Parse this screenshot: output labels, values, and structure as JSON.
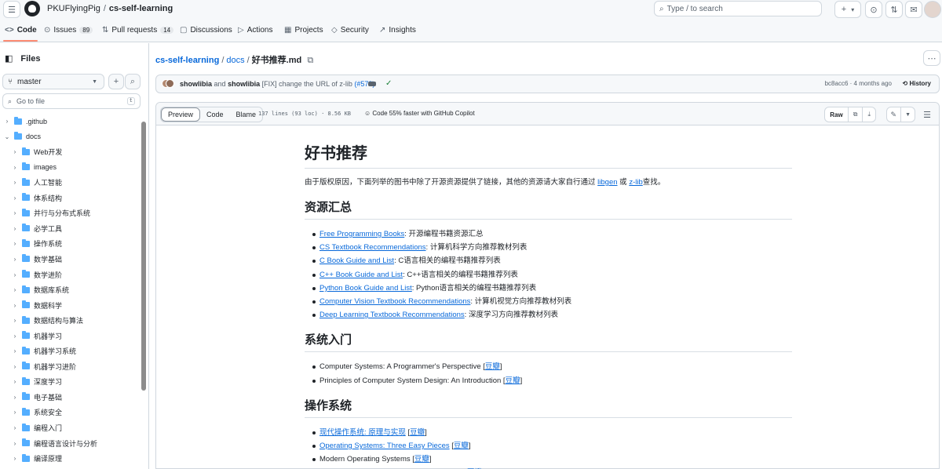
{
  "header": {
    "owner": "PKUFlyingPig",
    "repo": "cs-self-learning",
    "search_placeholder": "Type / to search",
    "search_key": "/",
    "plus": "+",
    "dropdown": "▾"
  },
  "tabs": [
    {
      "label": "Code",
      "icon": "<>",
      "count": ""
    },
    {
      "label": "Issues",
      "icon": "⊙",
      "count": "89"
    },
    {
      "label": "Pull requests",
      "icon": "⇅",
      "count": "14"
    },
    {
      "label": "Discussions",
      "icon": "▢",
      "count": ""
    },
    {
      "label": "Actions",
      "icon": "▷",
      "count": ""
    },
    {
      "label": "Projects",
      "icon": "▦",
      "count": ""
    },
    {
      "label": "Security",
      "icon": "◇",
      "count": ""
    },
    {
      "label": "Insights",
      "icon": "↗",
      "count": ""
    }
  ],
  "sidebar": {
    "title": "Files",
    "branch": "master",
    "goto_placeholder": "Go to file",
    "goto_key": "t",
    "items": [
      {
        "label": ".github",
        "expanded": false,
        "level": 0
      },
      {
        "label": "docs",
        "expanded": true,
        "level": 0
      },
      {
        "label": "Web开发",
        "expanded": false,
        "level": 1
      },
      {
        "label": "images",
        "expanded": false,
        "level": 1
      },
      {
        "label": "人工智能",
        "expanded": false,
        "level": 1
      },
      {
        "label": "体系结构",
        "expanded": false,
        "level": 1
      },
      {
        "label": "并行与分布式系统",
        "expanded": false,
        "level": 1
      },
      {
        "label": "必学工具",
        "expanded": false,
        "level": 1
      },
      {
        "label": "操作系统",
        "expanded": false,
        "level": 1
      },
      {
        "label": "数学基础",
        "expanded": false,
        "level": 1
      },
      {
        "label": "数学进阶",
        "expanded": false,
        "level": 1
      },
      {
        "label": "数据库系统",
        "expanded": false,
        "level": 1
      },
      {
        "label": "数据科学",
        "expanded": false,
        "level": 1
      },
      {
        "label": "数据结构与算法",
        "expanded": false,
        "level": 1
      },
      {
        "label": "机器学习",
        "expanded": false,
        "level": 1
      },
      {
        "label": "机器学习系统",
        "expanded": false,
        "level": 1
      },
      {
        "label": "机器学习进阶",
        "expanded": false,
        "level": 1
      },
      {
        "label": "深度学习",
        "expanded": false,
        "level": 1
      },
      {
        "label": "电子基础",
        "expanded": false,
        "level": 1
      },
      {
        "label": "系统安全",
        "expanded": false,
        "level": 1
      },
      {
        "label": "编程入门",
        "expanded": false,
        "level": 1
      },
      {
        "label": "编程语言设计与分析",
        "expanded": false,
        "level": 1
      },
      {
        "label": "编译原理",
        "expanded": false,
        "level": 1
      }
    ]
  },
  "breadcrumb": {
    "repo": "cs-self-learning",
    "dir": "docs",
    "file": "好书推荐.md"
  },
  "commit": {
    "author1": "showlibia",
    "and": "and",
    "author2": "showlibia",
    "message": "[FIX] change the URL of z-lib",
    "pr": "(#578)",
    "hash_time": "bc8acc6 · 4 months ago",
    "history": "History"
  },
  "file_header": {
    "views": [
      "Preview",
      "Code",
      "Blame"
    ],
    "meta": "137 lines (93 loc) · 8.56 KB",
    "copilot": "Code 55% faster with GitHub Copilot",
    "raw": "Raw"
  },
  "markdown": {
    "title": "好书推荐",
    "intro_before": "由于版权原因，下面列举的图书中除了开源资源提供了链接，其他的资源请大家自行通过",
    "intro_link1": "libgen",
    "intro_or": "或",
    "intro_link2": "z-lib",
    "intro_after": "查找。",
    "sections": [
      {
        "heading": "资源汇总",
        "items": [
          {
            "link": "Free Programming Books",
            "rest": ": 开源编程书籍资源汇总"
          },
          {
            "link": "CS Textbook Recommendations",
            "rest": ": 计算机科学方向推荐教材列表"
          },
          {
            "link": "C Book Guide and List",
            "rest": ": C语言相关的编程书籍推荐列表"
          },
          {
            "link": "C++ Book Guide and List",
            "rest": ": C++语言相关的编程书籍推荐列表"
          },
          {
            "link": "Python Book Guide and List",
            "rest": ": Python语言相关的编程书籍推荐列表"
          },
          {
            "link": "Computer Vision Textbook Recommendations",
            "rest": ": 计算机视觉方向推荐教材列表"
          },
          {
            "link": "Deep Learning Textbook Recommendations",
            "rest": ": 深度学习方向推荐教材列表"
          }
        ]
      },
      {
        "heading": "系统入门",
        "items": [
          {
            "text": "Computer Systems: A Programmer's Perspective",
            "ref": "豆瓣"
          },
          {
            "text": "Principles of Computer System Design: An Introduction",
            "ref": "豆瓣"
          }
        ]
      },
      {
        "heading": "操作系统",
        "items": [
          {
            "link": "现代操作系统: 原理与实现",
            "ref": "豆瓣"
          },
          {
            "link": "Operating Systems: Three Easy Pieces",
            "ref": "豆瓣"
          },
          {
            "text": "Modern Operating Systems",
            "ref": "豆瓣"
          },
          {
            "text": "Operating Systems: Principles and Practice",
            "ref": "豆瓣"
          }
        ]
      }
    ]
  }
}
